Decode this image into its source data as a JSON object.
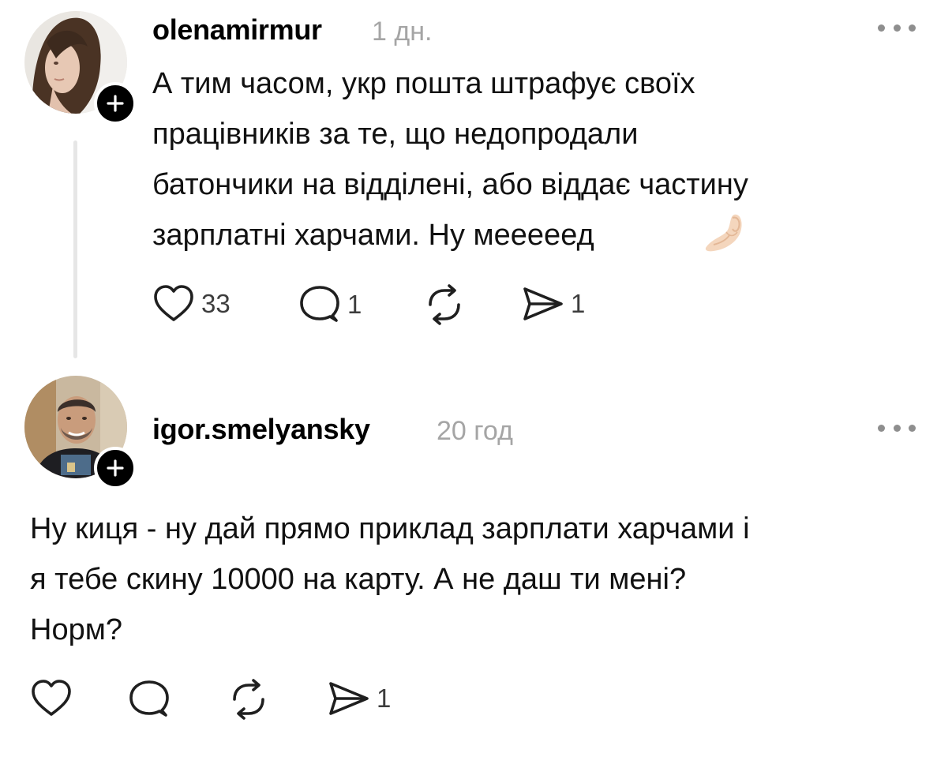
{
  "posts": [
    {
      "username": "olenamirmur",
      "time": "1 дн.",
      "text": "А тим часом, укр пошта штрафує своїх\nпрацівників за те, що недопродали\nбатончики на відділені, або віддає частину\nзарплатні харчами. Ну мееееед",
      "emoji": "pinched-fingers-emoji",
      "avatar": "woman-portrait-avatar",
      "actions": {
        "likes": "33",
        "replies": "1",
        "reposts": "",
        "shares": "1"
      }
    },
    {
      "username": "igor.smelyansky",
      "time": "20 год",
      "text": "Ну киця - ну дай прямо приклад зарплати харчами і\nя тебе скину 10000 на карту. А не даш ти мені?\nНорм?",
      "avatar": "man-portrait-avatar",
      "actions": {
        "likes": "",
        "replies": "",
        "reposts": "",
        "shares": "1"
      }
    }
  ],
  "colors": {
    "text": "#111111",
    "muted": "#a5a5a5",
    "icon": "#1f1f1f",
    "thread_line": "#e6e6e6"
  }
}
